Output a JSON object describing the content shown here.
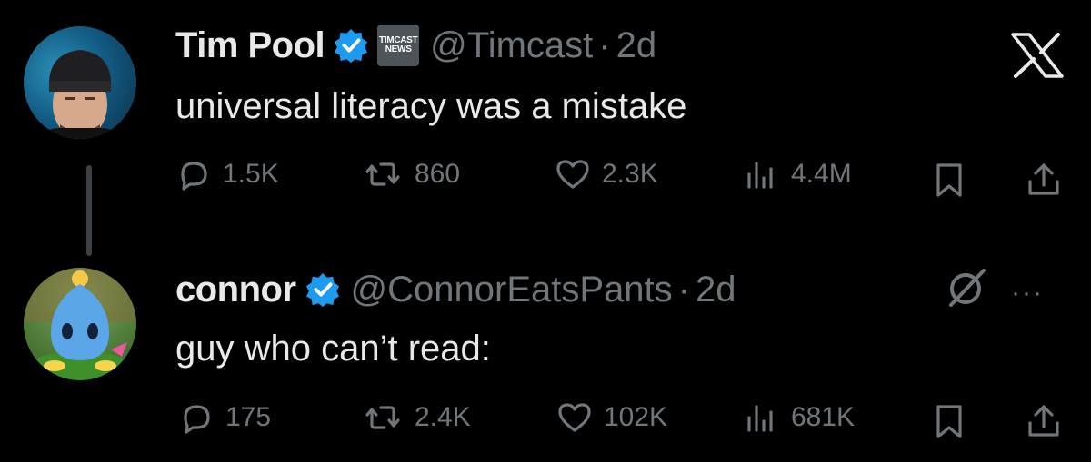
{
  "tweet1": {
    "name": "Tim Pool",
    "affiliation_badge": [
      "TIMCAST",
      "NEWS"
    ],
    "handle": "@Timcast",
    "separator": "·",
    "time": "2d",
    "text": "universal literacy was a mistake",
    "replies": "1.5K",
    "reposts": "860",
    "likes": "2.3K",
    "views": "4.4M"
  },
  "tweet2": {
    "name": "connor",
    "handle": "@ConnorEatsPants",
    "separator": "·",
    "time": "2d",
    "text": "guy who can’t read:",
    "replies": "175",
    "reposts": "2.4K",
    "likes": "102K",
    "views": "681K",
    "more": "···"
  },
  "colors": {
    "background": "#000000",
    "text": "#e7e9ea",
    "muted": "#71767b",
    "verified": "#1d9bf0"
  },
  "icons": [
    "x-logo-icon",
    "verified-icon",
    "reply-icon",
    "repost-icon",
    "like-icon",
    "views-icon",
    "bookmark-icon",
    "share-icon",
    "grok-icon",
    "more-icon"
  ]
}
